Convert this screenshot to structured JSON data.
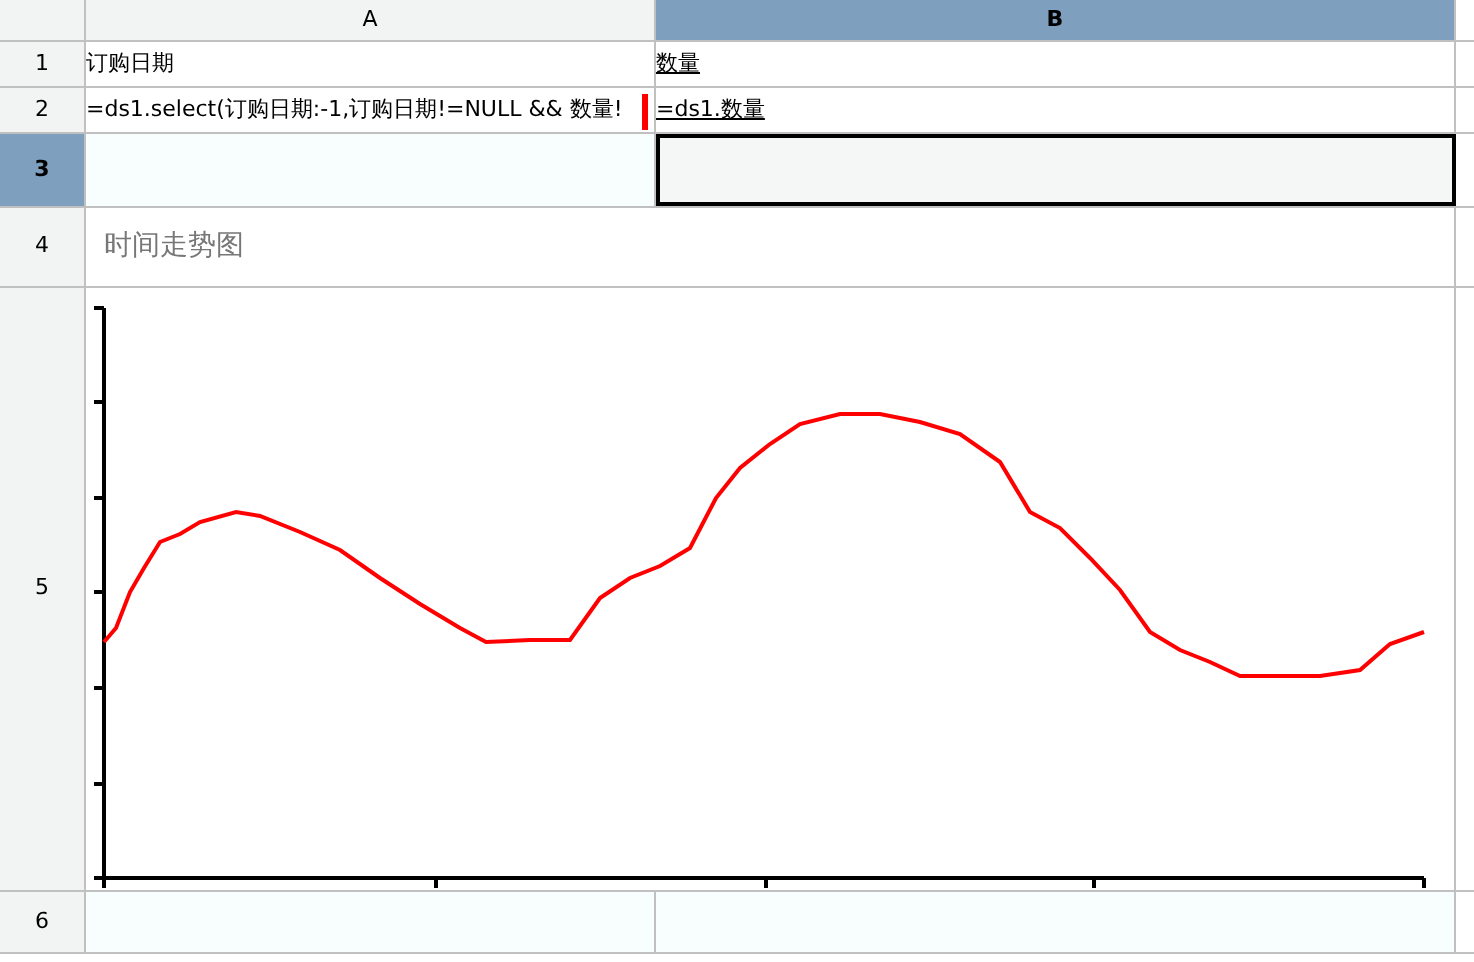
{
  "columns": [
    {
      "label": "A",
      "selected": false
    },
    {
      "label": "B",
      "selected": true
    }
  ],
  "rows": [
    {
      "label": "1",
      "selected": false,
      "kind": "cells",
      "cells": [
        {
          "text": "订购日期",
          "underline": false,
          "selected": false
        },
        {
          "text": "数量",
          "underline": true,
          "selected": false
        }
      ]
    },
    {
      "label": "2",
      "selected": false,
      "kind": "cells",
      "cells": [
        {
          "text": "=ds1.select(订购日期:-1,订购日期!=NULL && 数量!",
          "underline": false,
          "selected": false,
          "marker": true
        },
        {
          "text": "=ds1.数量",
          "underline": true,
          "selected": false
        }
      ]
    },
    {
      "label": "3",
      "selected": true,
      "kind": "cells",
      "cells": [
        {
          "selected": false
        },
        {
          "selected": true
        }
      ]
    },
    {
      "label": "4",
      "selected": false,
      "kind": "title",
      "text": "时间走势图"
    },
    {
      "label": "5",
      "selected": false,
      "kind": "chart"
    },
    {
      "label": "6",
      "selected": false,
      "kind": "cells",
      "cells": [
        {
          "selected": false
        },
        {
          "selected": false
        }
      ]
    }
  ]
}
